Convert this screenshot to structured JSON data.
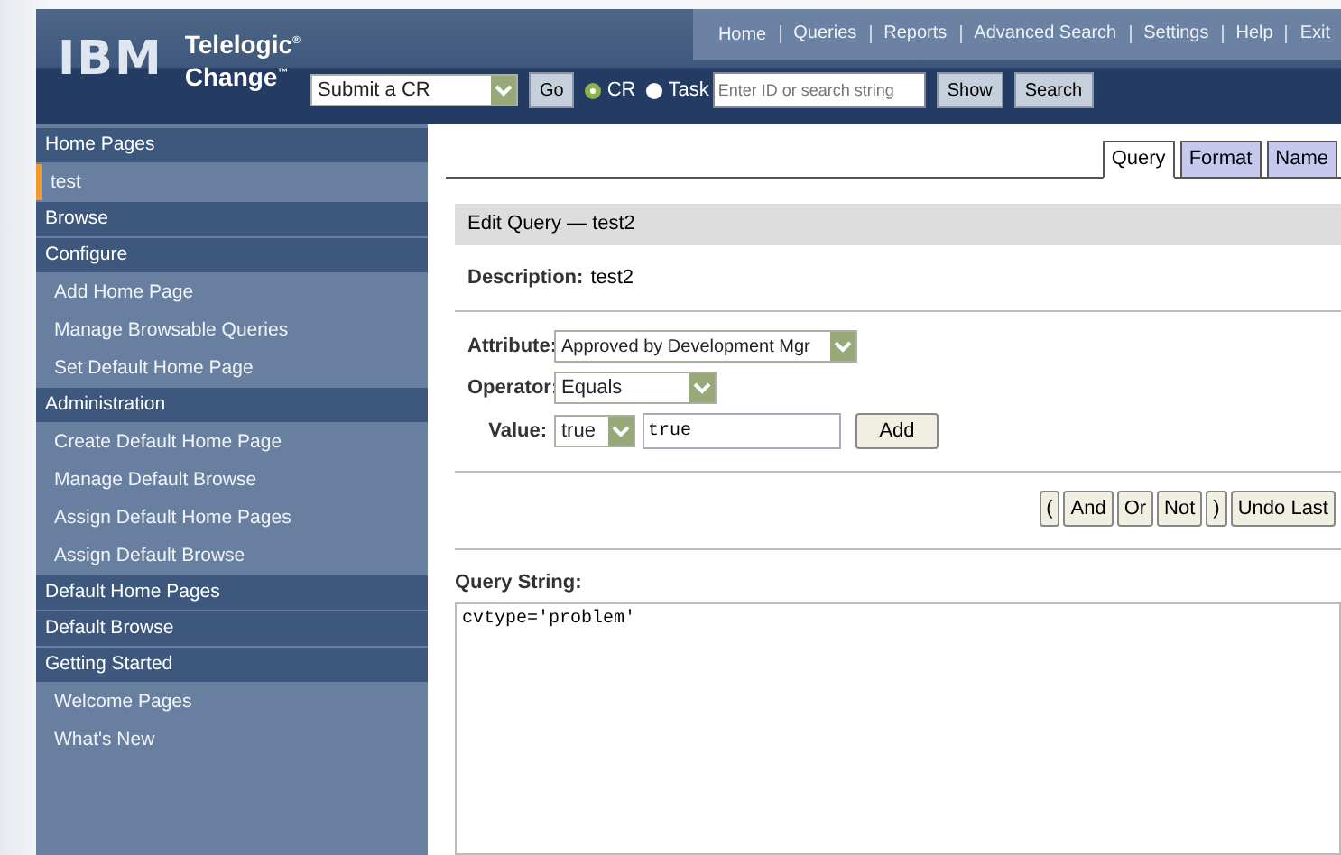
{
  "header": {
    "logo": "IBM",
    "product_line1": "Telelogic$^{®}$",
    "product_line2": "Change$^{™}$",
    "nav_links": [
      "Home",
      "Queries",
      "Reports",
      "Advanced Search",
      "Settings",
      "Help",
      "Exit"
    ],
    "action_select": {
      "value": "Submit a CR"
    },
    "go_button": "Go",
    "search_type": [
      {
        "label": "CR",
        "selected": true
      },
      {
        "label": "Task",
        "selected": false
      }
    ],
    "search_field": {
      "placeholder": "Enter ID or search string"
    },
    "show_button": "Show",
    "search_button": "Search"
  },
  "sidebar": {
    "items": [
      {
        "kind": "header",
        "label": "Home Pages"
      },
      {
        "kind": "item",
        "label": "test",
        "selected": true
      },
      {
        "kind": "header",
        "label": "Browse"
      },
      {
        "kind": "header",
        "label": "Configure"
      },
      {
        "kind": "item",
        "label": "Add Home Page",
        "selected": false
      },
      {
        "kind": "item",
        "label": "Manage Browsable Queries",
        "selected": false
      },
      {
        "kind": "item",
        "label": "Set Default Home Page",
        "selected": false
      },
      {
        "kind": "header",
        "label": "Administration"
      },
      {
        "kind": "item",
        "label": "Create Default Home Page",
        "selected": false
      },
      {
        "kind": "item",
        "label": "Manage Default Browse",
        "selected": false
      },
      {
        "kind": "item",
        "label": "Assign Default Home Pages",
        "selected": false
      },
      {
        "kind": "item",
        "label": "Assign Default Browse",
        "selected": false
      },
      {
        "kind": "header",
        "label": "Default Home Pages"
      },
      {
        "kind": "header",
        "label": "Default Browse"
      },
      {
        "kind": "header",
        "label": "Getting Started"
      },
      {
        "kind": "item",
        "label": "Welcome Pages",
        "selected": false
      },
      {
        "kind": "item",
        "label": "What's New",
        "selected": false
      }
    ]
  },
  "tabs": [
    {
      "label": "Query",
      "selected": true
    },
    {
      "label": "Format",
      "selected": false
    },
    {
      "label": "Name",
      "selected": false
    }
  ],
  "edit_title": "Edit Query — test2",
  "description": {
    "label": "Description:",
    "value": "test2"
  },
  "attribute": {
    "label": "Attribute:",
    "value": "Approved by Development Mgr"
  },
  "operator": {
    "label": "Operator:",
    "value": "Equals"
  },
  "value_row": {
    "label": "Value:",
    "select_value": "true",
    "text_value": "true",
    "add_button": "Add"
  },
  "logic_buttons": [
    "(",
    "And",
    "Or",
    "Not",
    ")",
    "Undo Last"
  ],
  "query_string": {
    "label": "Query String:",
    "value": "cvtype='problem'"
  }
}
